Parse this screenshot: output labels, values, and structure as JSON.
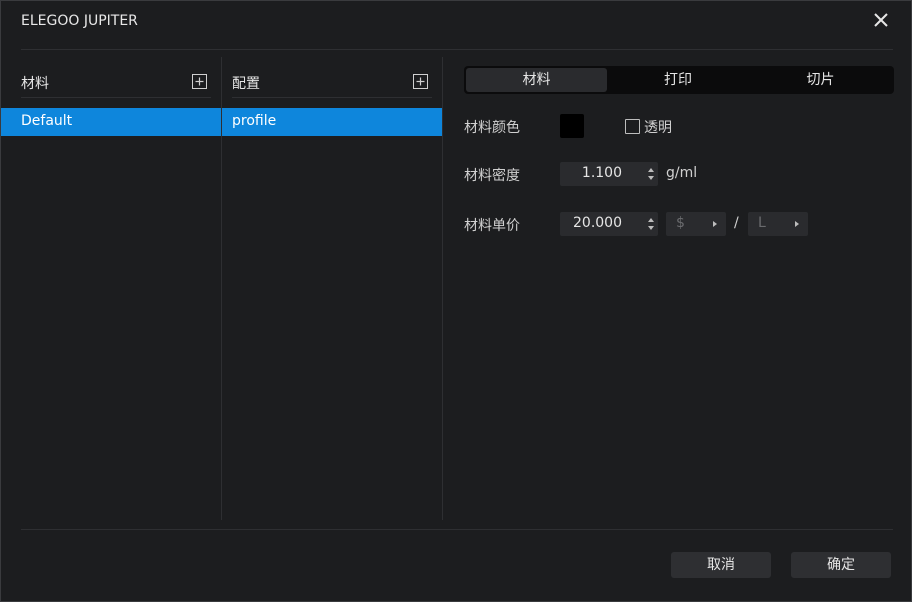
{
  "window": {
    "title": "ELEGOO JUPITER",
    "close_icon": "close-icon"
  },
  "materials": {
    "header": "材料",
    "add_icon": "add-square-icon",
    "items": [
      {
        "label": "Default",
        "selected": true
      }
    ]
  },
  "configs": {
    "header": "配置",
    "add_icon": "add-square-icon",
    "items": [
      {
        "label": "profile",
        "selected": true
      }
    ]
  },
  "tabs": [
    {
      "label": "材料",
      "active": true
    },
    {
      "label": "打印",
      "active": false
    },
    {
      "label": "切片",
      "active": false
    }
  ],
  "properties": {
    "color": {
      "label": "材料颜色",
      "value": "#000000",
      "transparent_label": "透明",
      "transparent_checked": false
    },
    "density": {
      "label": "材料密度",
      "value": "1.100",
      "unit": "g/ml"
    },
    "price": {
      "label": "材料单价",
      "value": "20.000",
      "currency": "$",
      "separator": "/",
      "volume_unit": "L"
    }
  },
  "buttons": {
    "cancel": "取消",
    "confirm": "确定"
  },
  "colors": {
    "background": "#1c1d1f",
    "selection": "#0e86dc",
    "tab_bar": "#0b0b0c",
    "control": "#2a2b2e"
  }
}
